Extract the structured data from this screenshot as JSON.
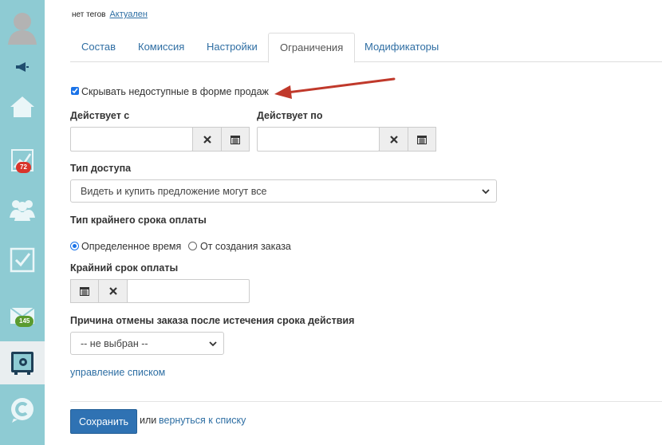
{
  "sidebar": {
    "badges": {
      "analytics": "72",
      "mail": "145"
    }
  },
  "header": {
    "tags_text": "нет тегов",
    "status_link": "Актуален"
  },
  "tabs": [
    {
      "label": "Состав"
    },
    {
      "label": "Комиссия"
    },
    {
      "label": "Настройки"
    },
    {
      "label": "Ограничения"
    },
    {
      "label": "Модификаторы"
    }
  ],
  "form": {
    "hide_unavailable_label": "Скрывать недоступные в форме продаж",
    "valid_from_label": "Действует с",
    "valid_to_label": "Действует по",
    "valid_from_value": "",
    "valid_to_value": "",
    "access_type_label": "Тип доступа",
    "access_type_value": "Видеть и купить предложение могут все",
    "deadline_type_label": "Тип крайнего срока оплаты",
    "deadline_option_1": "Определенное время",
    "deadline_option_2": "От создания заказа",
    "deadline_label": "Крайний срок оплаты",
    "deadline_value": "",
    "cancel_reason_label": "Причина отмены заказа после истечения срока действия",
    "cancel_reason_value": "-- не выбран --",
    "manage_list_link": "управление списком"
  },
  "footer": {
    "save_label": "Сохранить",
    "or_text": "или",
    "back_link": "вернуться к списку"
  },
  "colors": {
    "sidebar": "#8ecbd3",
    "link": "#2d6ea3",
    "primary": "#2f72b3",
    "arrow": "#c0392b",
    "badge_red": "#d9342b",
    "badge_green": "#5a9b2f"
  }
}
